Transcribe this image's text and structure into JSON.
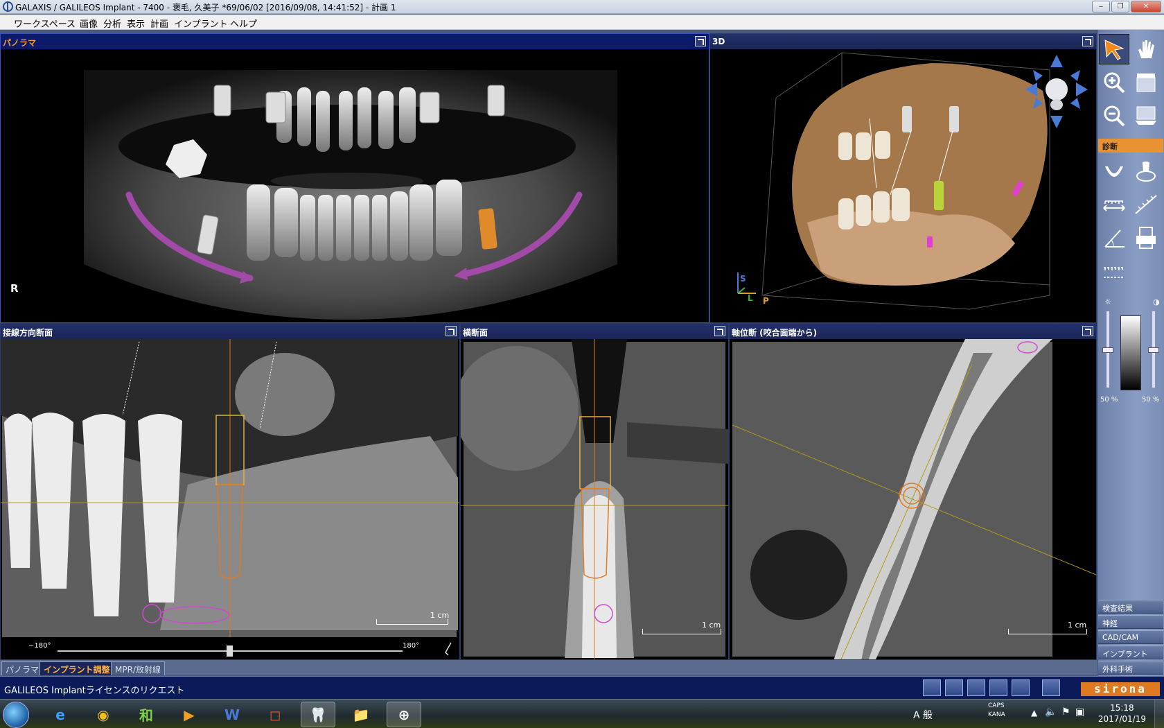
{
  "window": {
    "title": "GALAXIS / GALILEOS Implant - 7400 - 褒毛, 久美子 *69/06/02 [2016/09/08, 14:41:52] - 計画 1",
    "minimize": "‒",
    "restore": "❐",
    "close": "✕"
  },
  "menu": [
    "ワークスペース",
    "画像",
    "分析",
    "表示",
    "計画",
    "インプラント",
    "ヘルプ"
  ],
  "panels": {
    "panorama": {
      "title": "パノラマ",
      "side_marker": "R"
    },
    "view3d": {
      "title": "3D",
      "axis_s": "S",
      "axis_l": "L",
      "axis_p": "P"
    },
    "tangential": {
      "title": "接線方向断面",
      "scale": "1 cm",
      "angle_min": "−180°",
      "angle_max": "180°"
    },
    "cross": {
      "title": "横断面",
      "scale": "1 cm"
    },
    "axial": {
      "title": "軸位断 (咬合面端から)",
      "scale": "1 cm"
    }
  },
  "toolbar": {
    "section_diagnosis": "診断",
    "brightness_value": "50 %",
    "contrast_value": "50 %",
    "buttons": [
      "検査結果",
      "神経",
      "CAD/CAM",
      "インプラント",
      "外科手術"
    ]
  },
  "tabs": [
    "パノラマ",
    "インプラント調整",
    "MPR/放射線"
  ],
  "active_tab": 1,
  "status": {
    "message": "GALILEOS Implantライセンスのリクエスト",
    "brand": "sirona"
  },
  "taskbar": {
    "apps": [
      "e",
      "◉",
      "和",
      "▶",
      "W",
      "◻",
      "🦷",
      "📁",
      "⊕"
    ],
    "ime": "A 般",
    "caps": "CAPS",
    "kana": "KANA",
    "time": "15:18",
    "date": "2017/01/19"
  }
}
